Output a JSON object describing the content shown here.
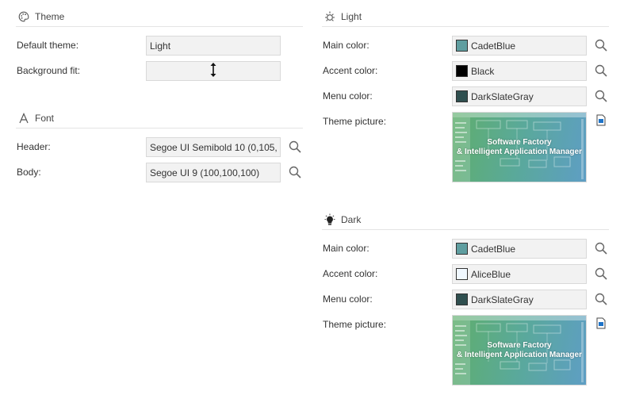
{
  "theme": {
    "title": "Theme",
    "default_theme_label": "Default theme:",
    "default_theme_value": "Light",
    "background_fit_label": "Background fit:"
  },
  "font": {
    "title": "Font",
    "header_label": "Header:",
    "header_value": "Segoe UI Semibold 10 (0,105,",
    "body_label": "Body:",
    "body_value": "Segoe UI 9 (100,100,100)"
  },
  "light": {
    "title": "Light",
    "main_color_label": "Main color:",
    "main_color_value": "CadetBlue",
    "main_color_hex": "#5f9ea0",
    "accent_color_label": "Accent color:",
    "accent_color_value": "Black",
    "accent_color_hex": "#000000",
    "menu_color_label": "Menu color:",
    "menu_color_value": "DarkSlateGray",
    "menu_color_hex": "#2f4f4f",
    "picture_label": "Theme picture:",
    "picture_caption_line1": "Software Factory",
    "picture_caption_line2": "& Intelligent Application Manager"
  },
  "dark": {
    "title": "Dark",
    "main_color_label": "Main color:",
    "main_color_value": "CadetBlue",
    "main_color_hex": "#5f9ea0",
    "accent_color_label": "Accent color:",
    "accent_color_value": "AliceBlue",
    "accent_color_hex": "#f0f8ff",
    "menu_color_label": "Menu color:",
    "menu_color_value": "DarkSlateGray",
    "menu_color_hex": "#2f4f4f",
    "picture_label": "Theme picture:",
    "picture_caption_line1": "Software Factory",
    "picture_caption_line2": "& Intelligent Application Manager"
  },
  "icons": {
    "theme": "palette-icon",
    "font": "font-icon",
    "light": "sun-icon",
    "dark": "lightbulb-icon",
    "search": "search-icon",
    "file": "file-icon",
    "resize": "vertical-resize-icon"
  }
}
